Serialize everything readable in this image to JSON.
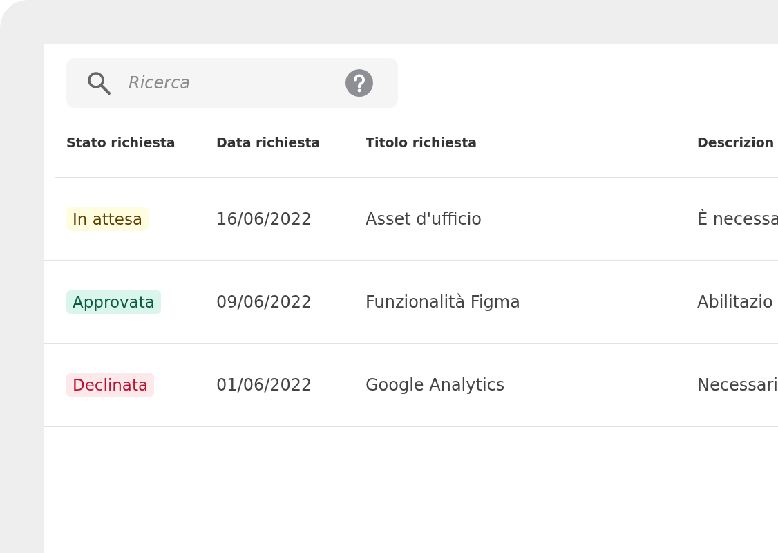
{
  "search": {
    "placeholder": "Ricerca"
  },
  "table": {
    "columns": [
      "Stato richiesta",
      "Data richiesta",
      "Titolo richiesta",
      "Descrizion"
    ],
    "rows": [
      {
        "status": {
          "label": "In attesa",
          "kind": "pending"
        },
        "date": "16/06/2022",
        "title": "Asset d'ufficio",
        "description": "È necessa"
      },
      {
        "status": {
          "label": "Approvata",
          "kind": "approved"
        },
        "date": "09/06/2022",
        "title": "Funzionalità Figma",
        "description": "Abilitazio"
      },
      {
        "status": {
          "label": "Declinata",
          "kind": "declined"
        },
        "date": "01/06/2022",
        "title": "Google Analytics",
        "description": "Necessari"
      }
    ]
  }
}
